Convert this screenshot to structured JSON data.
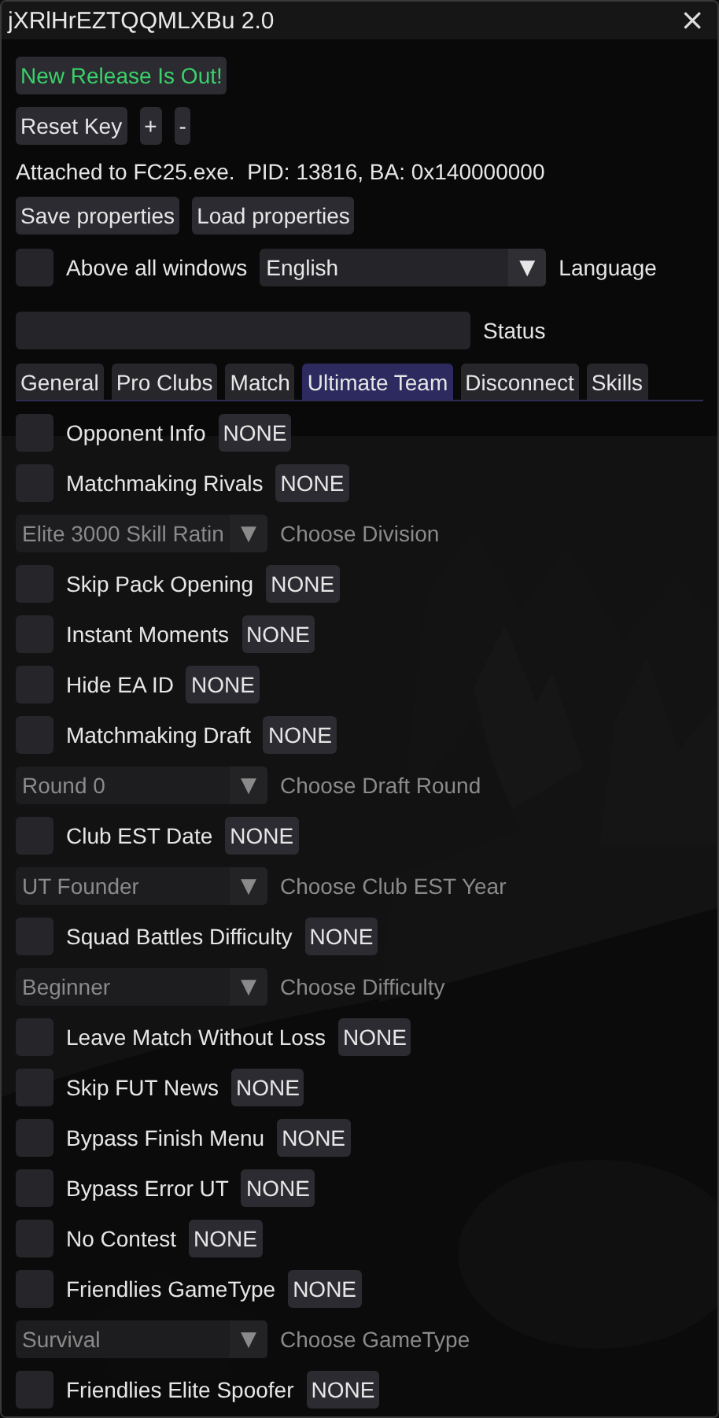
{
  "window": {
    "title": "jXRlHrEZTQQMLXBu 2.0",
    "close": "×"
  },
  "release_button": "New Release Is Out!",
  "key_buttons": [
    "Reset Key",
    "+",
    "-"
  ],
  "attached_text": "Attached to FC25.exe.  PID: 13816, BA: 0x140000000",
  "property_buttons": [
    "Save properties",
    "Load properties"
  ],
  "above_all": {
    "label": "Above all windows",
    "checked": false
  },
  "language": {
    "option": "English",
    "arrow": "▼",
    "label": "Language",
    "disabled": false
  },
  "status": {
    "label": "Status"
  },
  "tabs": [
    {
      "label": "General",
      "selected": false
    },
    {
      "label": "Pro Clubs",
      "selected": false
    },
    {
      "label": "Match",
      "selected": false
    },
    {
      "label": "Ultimate Team",
      "selected": true
    },
    {
      "label": "Disconnect",
      "selected": false
    },
    {
      "label": "Skills",
      "selected": false
    }
  ],
  "background": {
    "kind": "picture"
  },
  "items": [
    {
      "kind": "toggle",
      "label": "Opponent Info",
      "checked": false,
      "key": "NONE"
    },
    {
      "kind": "toggle",
      "label": "Matchmaking Rivals",
      "checked": false,
      "key": "NONE"
    },
    {
      "kind": "combo",
      "option": "Elite 3000 Skill Ratin",
      "arrow": "▼",
      "label": "Choose Division",
      "disabled": true
    },
    {
      "kind": "toggle",
      "label": "Skip Pack Opening",
      "checked": false,
      "key": "NONE"
    },
    {
      "kind": "toggle",
      "label": "Instant Moments",
      "checked": false,
      "key": "NONE"
    },
    {
      "kind": "toggle",
      "label": "Hide EA ID",
      "checked": false,
      "key": "NONE"
    },
    {
      "kind": "toggle",
      "label": "Matchmaking Draft",
      "checked": false,
      "key": "NONE"
    },
    {
      "kind": "combo",
      "option": "Round 0",
      "arrow": "▼",
      "label": "Choose Draft Round",
      "disabled": true
    },
    {
      "kind": "toggle",
      "label": "Club EST Date",
      "checked": false,
      "key": "NONE"
    },
    {
      "kind": "combo",
      "option": "UT Founder",
      "arrow": "▼",
      "label": "Choose Club EST Year",
      "disabled": true
    },
    {
      "kind": "toggle",
      "label": "Squad Battles Difficulty",
      "checked": false,
      "key": "NONE"
    },
    {
      "kind": "combo",
      "option": "Beginner",
      "arrow": "▼",
      "label": "Choose Difficulty",
      "disabled": true
    },
    {
      "kind": "toggle",
      "label": "Leave Match Without Loss",
      "checked": false,
      "key": "NONE"
    },
    {
      "kind": "toggle",
      "label": "Skip FUT News",
      "checked": false,
      "key": "NONE"
    },
    {
      "kind": "toggle",
      "label": "Bypass Finish Menu",
      "checked": false,
      "key": "NONE"
    },
    {
      "kind": "toggle",
      "label": "Bypass Error UT",
      "checked": false,
      "key": "NONE"
    },
    {
      "kind": "toggle",
      "label": "No Contest",
      "checked": false,
      "key": "NONE"
    },
    {
      "kind": "toggle",
      "label": "Friendlies GameType",
      "checked": false,
      "key": "NONE"
    },
    {
      "kind": "combo",
      "option": "Survival",
      "arrow": "▼",
      "label": "Choose GameType",
      "disabled": true
    },
    {
      "kind": "toggle",
      "label": "Friendlies Elite Spoofer",
      "checked": false,
      "key": "NONE"
    }
  ]
}
